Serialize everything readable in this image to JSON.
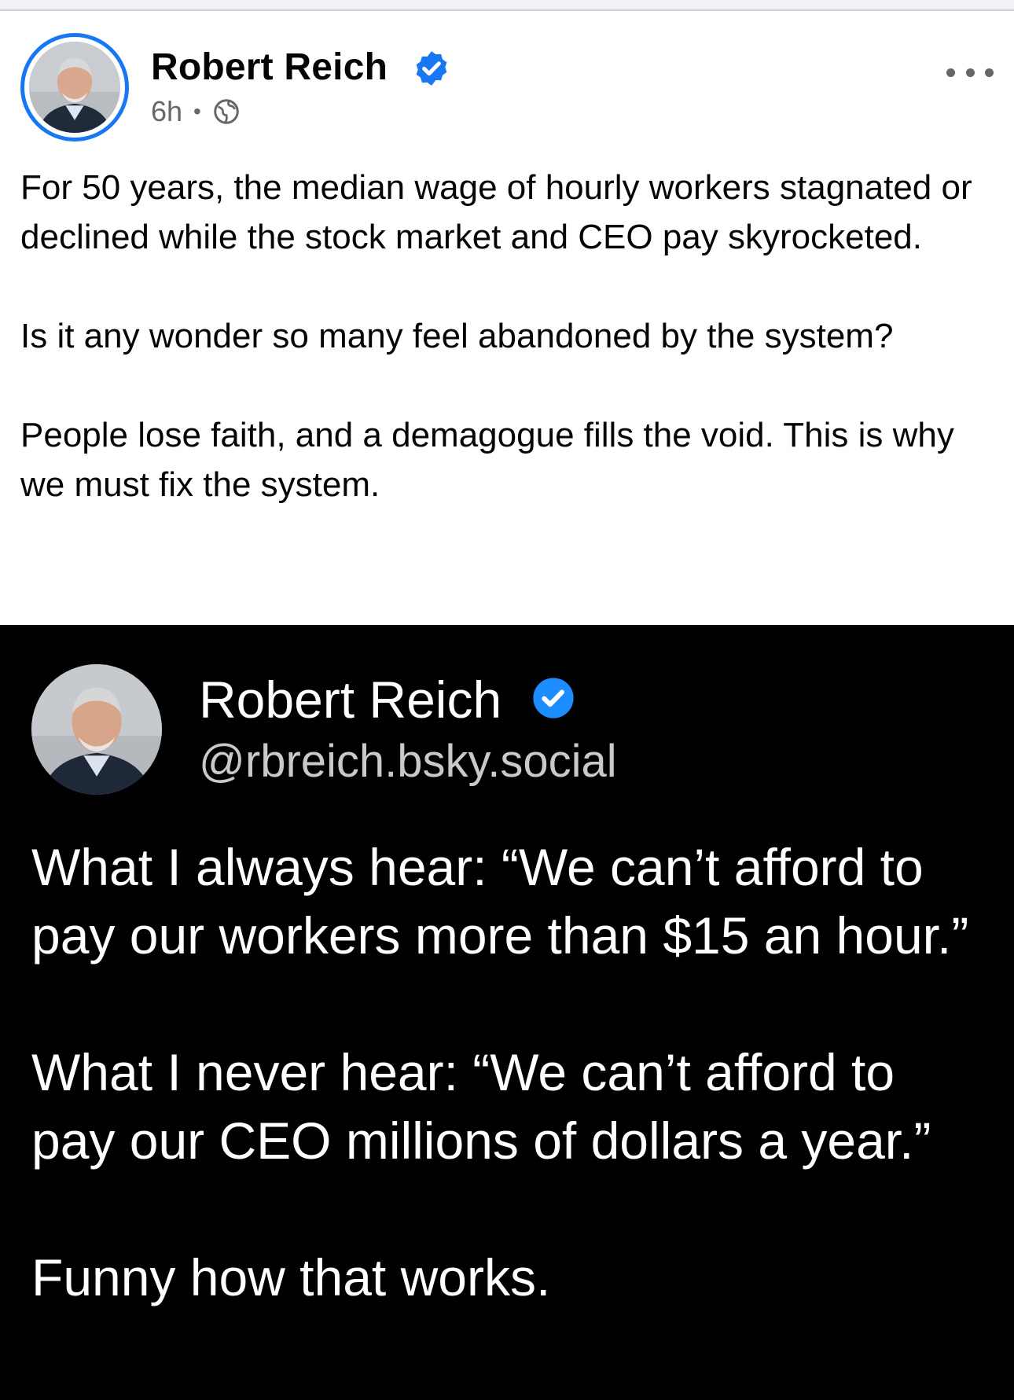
{
  "post": {
    "author": "Robert Reich",
    "time": "6h",
    "separator": "•",
    "audience_icon": "globe-icon",
    "more_icon": "more-options-icon",
    "paragraphs": [
      "For 50 years, the median wage of hourly workers stagnated or declined while the stock market and CEO pay skyrocketed.",
      "Is it any wonder so many feel abandoned by the system?",
      "People lose faith, and a demagogue fills the void. This is why we must fix the system."
    ]
  },
  "embed": {
    "name": "Robert Reich",
    "handle": "@rbreich.bsky.social",
    "paragraphs": [
      "What I always hear: “We can’t afford to pay our workers more than $15 an hour.”",
      "What I never hear: “We can’t afford to pay our CEO millions of dollars a year.”",
      "Funny how that works."
    ]
  },
  "colors": {
    "accent": "#1877f2",
    "verified_embed": "#1d8cff",
    "meta_text": "#65676b",
    "embed_bg": "#000000"
  }
}
